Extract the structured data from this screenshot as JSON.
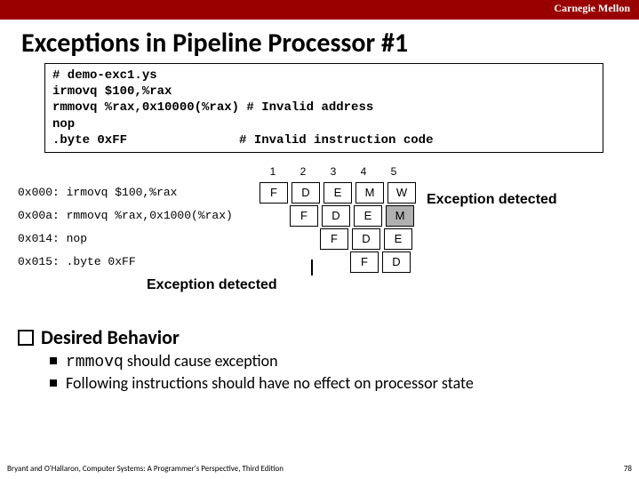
{
  "brand": "Carnegie Mellon",
  "title": "Exceptions in Pipeline Processor #1",
  "code": "# demo-exc1.ys\nirmovq $100,%rax\nrmmovq %rax,0x10000(%rax) # Invalid address\nnop\n.byte 0xFF               # Invalid instruction code",
  "stages": [
    "1",
    "2",
    "3",
    "4",
    "5"
  ],
  "rows": [
    {
      "addr": "0x000:",
      "instr": "irmovq $100,%rax",
      "cells": [
        "F",
        "D",
        "E",
        "M",
        "W"
      ],
      "offset": 0,
      "hl": []
    },
    {
      "addr": "0x00a:",
      "instr": "rmmovq %rax,0x1000(%rax)",
      "cells": [
        "F",
        "D",
        "E",
        "M"
      ],
      "offset": 1,
      "hl": [
        3
      ]
    },
    {
      "addr": "0x014:",
      "instr": "nop",
      "cells": [
        "F",
        "D",
        "E"
      ],
      "offset": 2,
      "hl": []
    },
    {
      "addr": "0x015:",
      "instr": ".byte 0xFF",
      "cells": [
        "F",
        "D"
      ],
      "offset": 3,
      "hl": []
    }
  ],
  "exc_label_top": "Exception detected",
  "exc_label_bot": "Exception detected",
  "section": "Desired Behavior",
  "bullets": [
    {
      "pre": "rmmovq",
      "post": " should cause exception"
    },
    {
      "pre": "",
      "post": "Following instructions should have no effect on processor state"
    }
  ],
  "footer_left": "Bryant and O'Hallaron, Computer Systems: A Programmer's Perspective, Third Edition",
  "footer_right": "78"
}
